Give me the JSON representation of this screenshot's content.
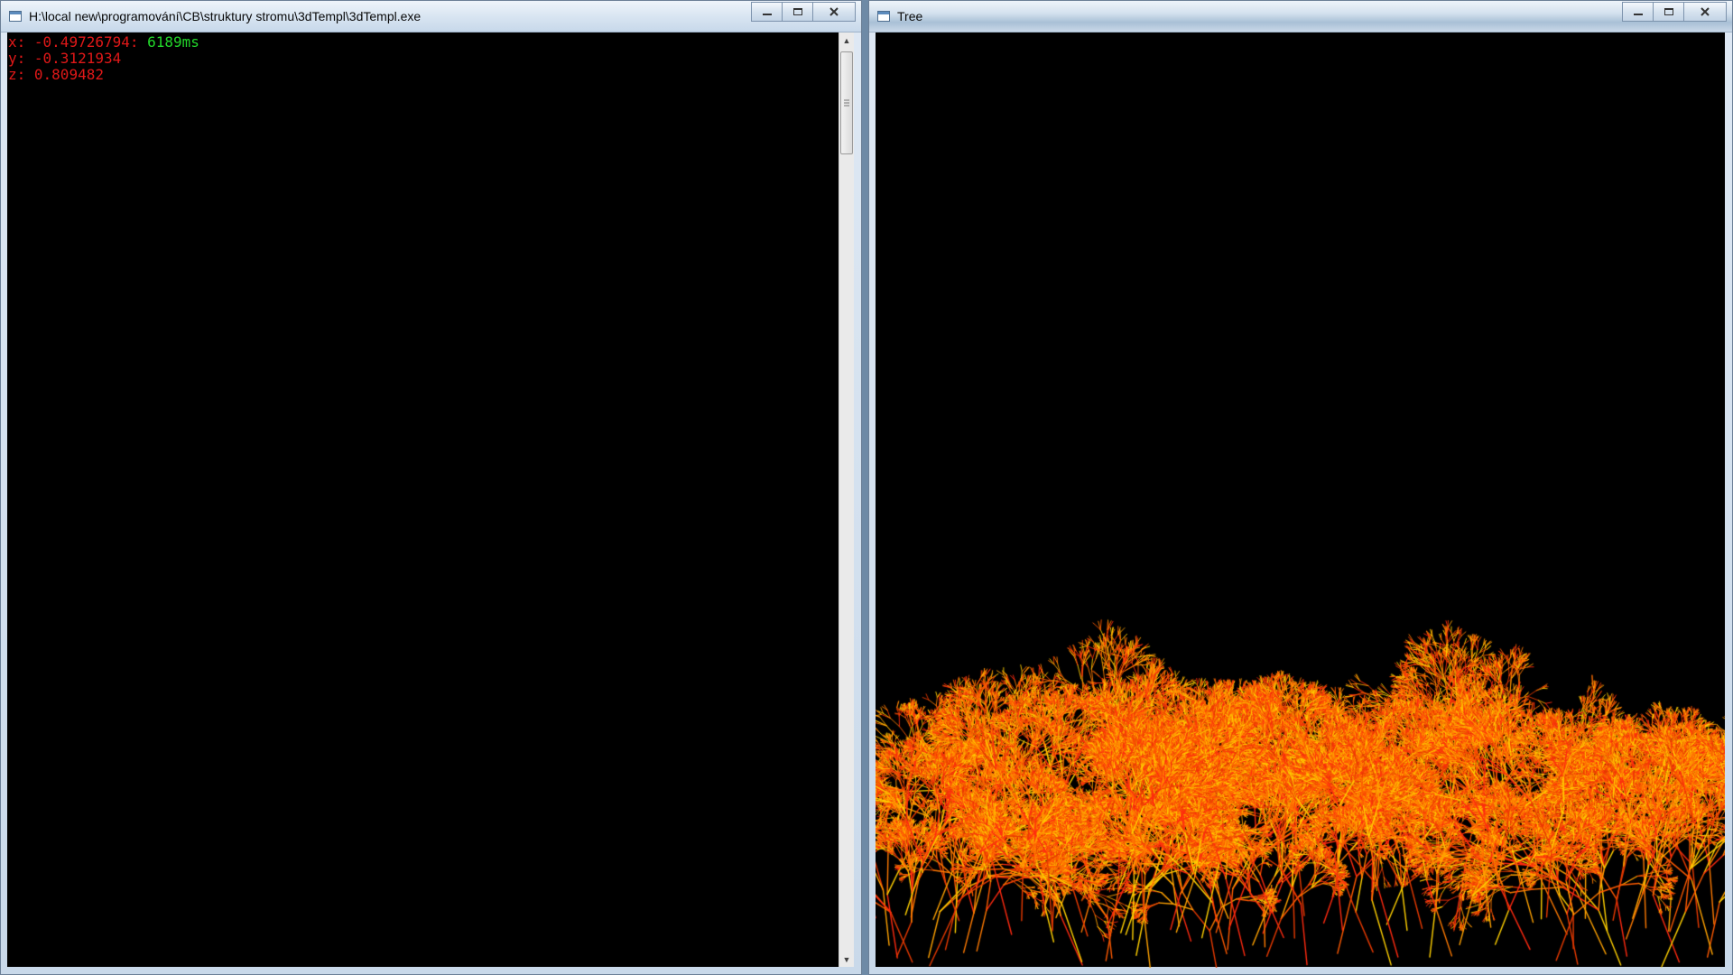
{
  "console_window": {
    "title": "H:\\local new\\programování\\CB\\struktury stromu\\3dTempl\\3dTempl.exe",
    "icon": "console-app-icon",
    "output": {
      "x_label": "x: ",
      "x_value": "-0.49726794",
      "separator": ": ",
      "timing": "6189ms",
      "y_label": "y: ",
      "y_value": "-0.3121934",
      "z_label": "z: ",
      "z_value": "0.809482"
    },
    "colors": {
      "coordinates": "#e01818",
      "timing": "#22d62a",
      "background": "#000000"
    }
  },
  "tree_window": {
    "title": "Tree",
    "icon": "app-window-icon",
    "render": {
      "description_icon": "fractal-tree-render",
      "palette": [
        "#ff7a00",
        "#ff5a00",
        "#ffa200",
        "#ffd000",
        "#ff2a10",
        "#e83a00"
      ],
      "background": "#000000"
    }
  },
  "caption_buttons": {
    "minimize_icon": "minimize-icon",
    "maximize_icon": "maximize-icon",
    "close_icon": "close-icon"
  }
}
